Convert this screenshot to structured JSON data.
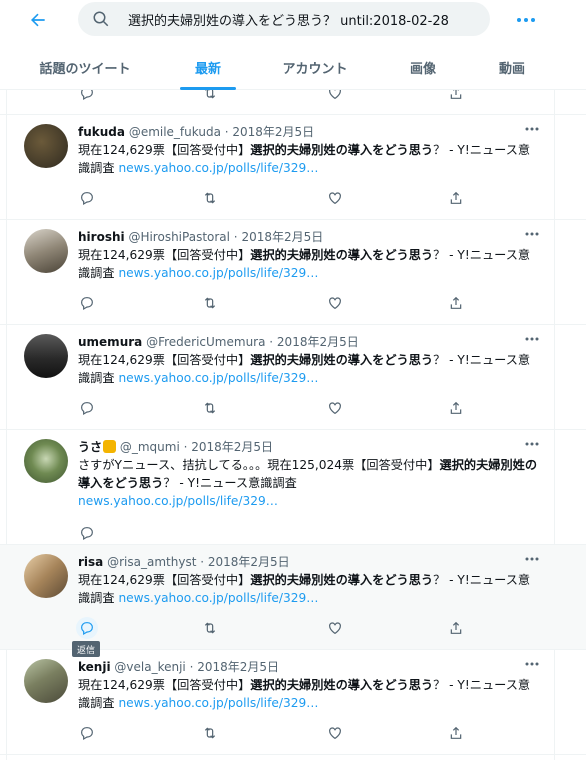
{
  "search": {
    "value": "選択的夫婦別姓の導入をどう思う？ until:2018-02-28"
  },
  "tabs": [
    {
      "label": "話題のツイート"
    },
    {
      "label": "最新"
    },
    {
      "label": "アカウント"
    },
    {
      "label": "画像"
    },
    {
      "label": "動画"
    }
  ],
  "active_tab": "最新",
  "colors": {
    "accent": "#1d9bf0",
    "muted": "#536471",
    "text": "#0f1419"
  },
  "icons": [
    "back-arrow-icon",
    "search-icon",
    "more-icon",
    "reply-icon",
    "retweet-icon",
    "like-icon",
    "share-icon"
  ],
  "tooltip": "返信",
  "tweets": [
    {
      "name": "fukuda",
      "handle": "@emile_fukuda",
      "sep": " · ",
      "date": "2018年2月5日",
      "t1": "現在124,629票【回答受付中】",
      "bold": "選択的夫婦別姓の導入をどう思う",
      "t2": "？ - Y!ニュース意識調査 ",
      "link": "news.yahoo.co.jp/polls/life/329…"
    },
    {
      "name": "hiroshi",
      "handle": "@HiroshiPastoral",
      "sep": " · ",
      "date": "2018年2月5日",
      "t1": "現在124,629票【回答受付中】",
      "bold": "選択的夫婦別姓の導入をどう思う",
      "t2": "？ - Y!ニュース意識調査 ",
      "link": "news.yahoo.co.jp/polls/life/329…"
    },
    {
      "name": "umemura",
      "handle": "@FredericUmemura",
      "sep": " · ",
      "date": "2018年2月5日",
      "t1": "現在124,629票【回答受付中】",
      "bold": "選択的夫婦別姓の導入をどう思う",
      "t2": "？ - Y!ニュース意識調査 ",
      "link": "news.yahoo.co.jp/polls/life/329…"
    },
    {
      "name": "うさ",
      "handle": "@_mqumi",
      "sep": " · ",
      "date": "2018年2月5日",
      "t1": "さすがYニュース、拮抗してる。。。現在125,024票【回答受付中】",
      "bold": "選択的夫婦別姓の導入をどう思う",
      "t2": "？ - Y!ニュース意識調査",
      "link": "news.yahoo.co.jp/polls/life/329…"
    },
    {
      "name": "risa",
      "handle": "@risa_amthyst",
      "sep": " · ",
      "date": "2018年2月5日",
      "t1": "現在124,629票【回答受付中】",
      "bold": "選択的夫婦別姓の導入をどう思う",
      "t2": "？ - Y!ニュース意識調査 ",
      "link": "news.yahoo.co.jp/polls/life/329…"
    },
    {
      "name": "kenji",
      "handle": "@vela_kenji",
      "sep": " · ",
      "date": "2018年2月5日",
      "t1": "現在124,629票【回答受付中】",
      "bold": "選択的夫婦別姓の導入をどう思う",
      "t2": "？ - Y!ニュース意識調査 ",
      "link": "news.yahoo.co.jp/polls/life/329…"
    }
  ]
}
